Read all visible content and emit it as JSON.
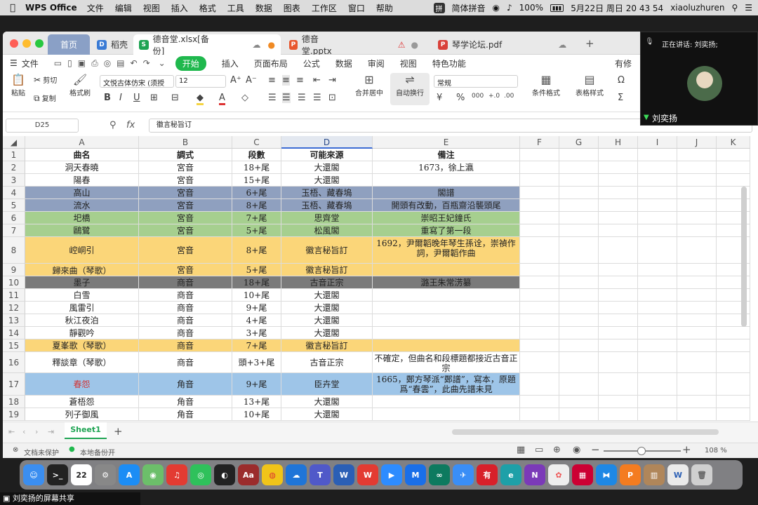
{
  "menubar": {
    "app_name": "WPS Office",
    "items": [
      "文件",
      "编辑",
      "视图",
      "插入",
      "格式",
      "工具",
      "数据",
      "图表",
      "工作区",
      "窗口",
      "帮助"
    ],
    "input_method": "简体拼音",
    "battery": "100%",
    "datetime": "5月22日 周日 20 43 54",
    "user": "xiaoluzhuren"
  },
  "tabs": {
    "home": "首页",
    "t1": "稻壳",
    "t2": "德音堂.xlsx[备份]",
    "t3": "德音堂.pptx",
    "t4": "琴学论坛.pdf"
  },
  "menurow": {
    "file": "文件",
    "start": "开始",
    "items": [
      "插入",
      "页面布局",
      "公式",
      "数据",
      "审阅",
      "视图",
      "特色功能"
    ],
    "right": "有修"
  },
  "ribbon": {
    "paste": "粘贴",
    "cut": "剪切",
    "copy": "复制",
    "format_painter": "格式刷",
    "font_name": "文悦古体仿宋 (须授",
    "font_size": "12",
    "merge": "合并居中",
    "wrap": "自动换行",
    "number_format": "常规",
    "cond_format": "条件格式",
    "table_style": "表格样式"
  },
  "formula": {
    "cell_ref": "D25",
    "fx": "fx",
    "content": "徽言秘旨订"
  },
  "columns": [
    "A",
    "B",
    "C",
    "D",
    "E",
    "F",
    "G",
    "H",
    "I",
    "J",
    "K"
  ],
  "rows": [
    {
      "n": "1",
      "a": "曲名",
      "b": "調式",
      "c": "段數",
      "d": "可能來源",
      "e": "備注"
    },
    {
      "n": "2",
      "a": "洞天春曉",
      "b": "宮音",
      "c": "18+尾",
      "d": "大還閣",
      "e": "1673，徐上瀛"
    },
    {
      "n": "3",
      "a": "陽春",
      "b": "宮音",
      "c": "15+尾",
      "d": "大還閣",
      "e": ""
    },
    {
      "n": "4",
      "a": "高山",
      "b": "宮音",
      "c": "6+尾",
      "d": "玉梧、藏春塢",
      "e": "閣譜"
    },
    {
      "n": "5",
      "a": "流水",
      "b": "宮音",
      "c": "8+尾",
      "d": "玉梧、藏春塢",
      "e": "開頭有改動，百瓶齋沿襲頭尾"
    },
    {
      "n": "6",
      "a": "圯橋",
      "b": "宮音",
      "c": "7+尾",
      "d": "思齊堂",
      "e": "崇昭王妃鐘氏"
    },
    {
      "n": "7",
      "a": "鷗鷺",
      "b": "宮音",
      "c": "5+尾",
      "d": "松風閣",
      "e": "重寫了第一段"
    },
    {
      "n": "8",
      "a": "崆峒引",
      "b": "宮音",
      "c": "8+尾",
      "d": "徽言秘旨訂",
      "e": "1692，尹爾韜晚年琴生孫诠，崇禎作詞，尹爾韜作曲"
    },
    {
      "n": "9",
      "a": "歸來曲（琴歌）",
      "b": "宮音",
      "c": "5+尾",
      "d": "徽言秘旨訂",
      "e": ""
    },
    {
      "n": "10",
      "a": "墨子",
      "b": "商音",
      "c": "18+尾",
      "d": "古音正宗",
      "e": "潞王朱常淓纂"
    },
    {
      "n": "11",
      "a": "白雪",
      "b": "商音",
      "c": "10+尾",
      "d": "大還閣",
      "e": ""
    },
    {
      "n": "12",
      "a": "風雷引",
      "b": "商音",
      "c": "9+尾",
      "d": "大還閣",
      "e": ""
    },
    {
      "n": "13",
      "a": "秋江夜泊",
      "b": "商音",
      "c": "4+尾",
      "d": "大還閣",
      "e": ""
    },
    {
      "n": "14",
      "a": "靜觀吟",
      "b": "商音",
      "c": "3+尾",
      "d": "大還閣",
      "e": ""
    },
    {
      "n": "15",
      "a": "夏峯歌（琴歌）",
      "b": "商音",
      "c": "7+尾",
      "d": "徽言秘旨訂",
      "e": ""
    },
    {
      "n": "16",
      "a": "釋談章（琴歌）",
      "b": "商音",
      "c": "頭+3+尾",
      "d": "古音正宗",
      "e": "不確定，但曲名和段標題都接近古音正宗"
    },
    {
      "n": "17",
      "a": "春怨",
      "b": "角音",
      "c": "9+尾",
      "d": "臣卉堂",
      "e": "1665，鄭方琴派“鄭譜”，寫本，原題爲“春雲”，此曲先譜未見"
    },
    {
      "n": "18",
      "a": "蒼梧怨",
      "b": "角音",
      "c": "13+尾",
      "d": "大還閣",
      "e": ""
    },
    {
      "n": "19",
      "a": "列子御風",
      "b": "角音",
      "c": "10+尾",
      "d": "大還閣",
      "e": ""
    }
  ],
  "colors": {
    "blue_gray": "#8fa0bf",
    "green": "#a6cf8f",
    "orange": "#fbd679",
    "dark_gray": "#7a7a7a",
    "light_blue": "#9ec5e8",
    "red_text": "#d33333"
  },
  "sheet": {
    "tab": "Sheet1",
    "add": "+"
  },
  "status": {
    "protect": "文档未保护",
    "backup": "本地备份开",
    "zoom": "108 %"
  },
  "meeting": {
    "speaking": "正在讲话: 刘奕扬;",
    "name": "刘奕扬"
  },
  "share": "刘奕扬的屏幕共享"
}
